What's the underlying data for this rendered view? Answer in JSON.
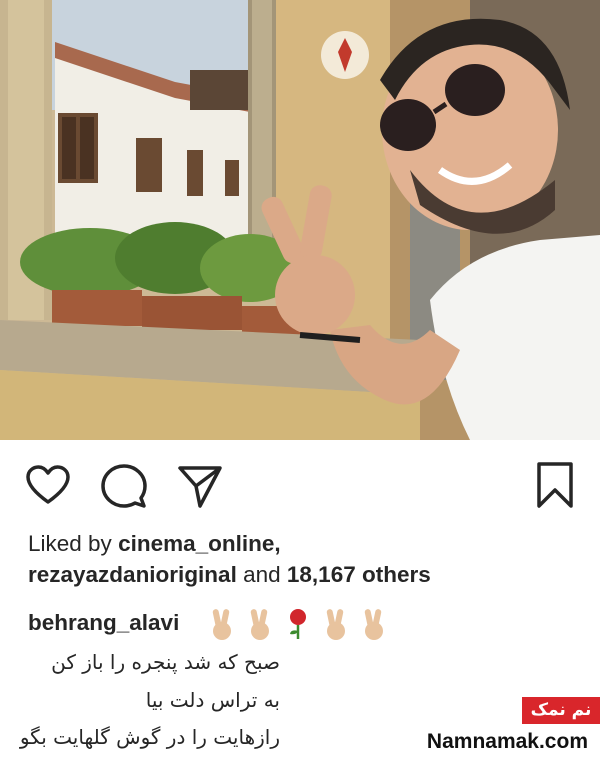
{
  "post": {
    "liked_by_prefix": "Liked by",
    "liker_one": "cinema_online",
    "liker_two": "rezayazdanioriginal",
    "and_text": "and",
    "others_count": "18,167",
    "others_text": "others",
    "caption_user": "behrang_alavi",
    "caption_emojis": [
      "victory-hand",
      "victory-hand",
      "rose",
      "victory-hand",
      "victory-hand"
    ],
    "caption_lines": [
      "صبح که شد پنجره را باز کن",
      "به تراس دلت بیا",
      "رازهایت را در گوش گلهایت بگو"
    ]
  },
  "actions": {
    "like_icon": "heart-icon",
    "comment_icon": "comment-icon",
    "share_icon": "paper-plane-icon",
    "save_icon": "bookmark-icon"
  },
  "watermark": {
    "badge": "نم نمک",
    "site": "Namnamak.com",
    "badge_color": "#d9262b"
  },
  "colors": {
    "text": "#262626",
    "background": "#ffffff"
  }
}
